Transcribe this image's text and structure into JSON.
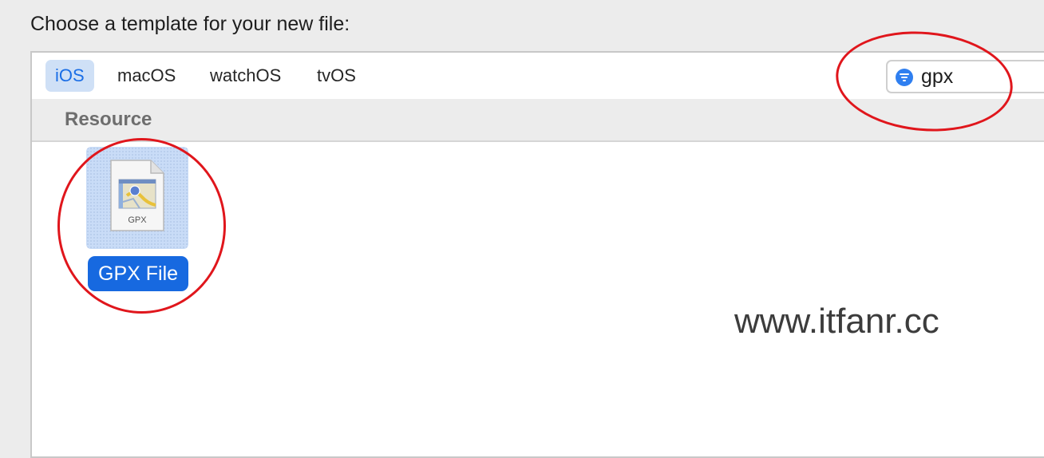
{
  "dialog": {
    "prompt": "Choose a template for your new file:"
  },
  "platform_tabs": [
    {
      "label": "iOS",
      "selected": true
    },
    {
      "label": "macOS",
      "selected": false
    },
    {
      "label": "watchOS",
      "selected": false
    },
    {
      "label": "tvOS",
      "selected": false
    }
  ],
  "search": {
    "value": "gpx",
    "icon": "filter-icon"
  },
  "section": {
    "title": "Resource"
  },
  "template": {
    "icon_text": "GPX",
    "label": "GPX File",
    "icon": "gpx-document-icon"
  },
  "watermark": "www.itfanr.cc",
  "colors": {
    "accent": "#1769e0",
    "annotation": "#e0161c"
  }
}
